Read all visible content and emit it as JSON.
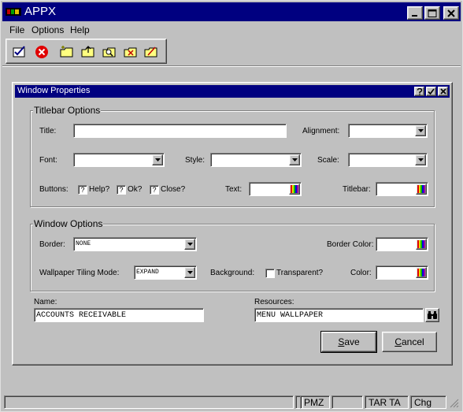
{
  "app": {
    "title": "APPX",
    "menu": [
      "File",
      "Options",
      "Help"
    ],
    "toolbar_icons": [
      "ok-check-icon",
      "cancel-x-icon",
      "new-folder-icon",
      "open-folder-icon",
      "find-folder-icon",
      "delete-folder-icon",
      "edit-folder-icon"
    ]
  },
  "dialog": {
    "title": "Window Properties",
    "titlebar_options": {
      "legend": "Titlebar Options",
      "title_label": "Title:",
      "title_value": "",
      "alignment_label": "Alignment:",
      "alignment_value": "",
      "font_label": "Font:",
      "font_value": "",
      "style_label": "Style:",
      "style_value": "",
      "scale_label": "Scale:",
      "scale_value": "",
      "buttons_label": "Buttons:",
      "help_label": "Help?",
      "ok_label": "Ok?",
      "close_label": "Close?",
      "tri_state_mark": "?",
      "text_label": "Text:",
      "titlebar_label": "Titlebar:"
    },
    "window_options": {
      "legend": "Window Options",
      "border_label": "Border:",
      "border_value": "NONE",
      "border_color_label": "Border Color:",
      "tiling_label": "Wallpaper Tiling Mode:",
      "tiling_value": "EXPAND",
      "background_label": "Background:",
      "transparent_label": "Transparent?",
      "color_label": "Color:"
    },
    "name_label": "Name:",
    "name_value": "ACCOUNTS RECEIVABLE",
    "resources_label": "Resources:",
    "resources_value": "MENU WALLPAPER",
    "save_label_pre": "",
    "save_label_u": "S",
    "save_label_post": "ave",
    "cancel_label_pre": "",
    "cancel_label_u": "C",
    "cancel_label_post": "ancel"
  },
  "statusbar": {
    "cells": [
      "",
      "",
      "PMZ",
      "",
      "TAR TA",
      "Chg"
    ]
  },
  "colors": {
    "titlebar": "#000080",
    "face": "#c0c0c0"
  }
}
